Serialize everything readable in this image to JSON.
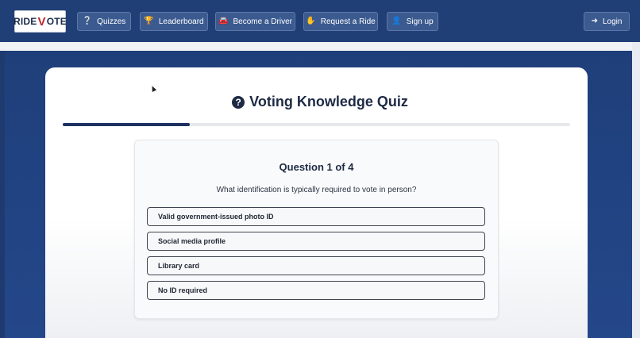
{
  "nav": {
    "logo_left": "RIDE",
    "logo_v": "V",
    "logo_right": "OTE",
    "items": [
      {
        "label": "Quizzes",
        "icon": "question-circle-icon"
      },
      {
        "label": "Leaderboard",
        "icon": "trophy-icon"
      },
      {
        "label": "Become a Driver",
        "icon": "car-icon"
      },
      {
        "label": "Request a Ride",
        "icon": "hand-icon"
      },
      {
        "label": "Sign up",
        "icon": "user-plus-icon"
      }
    ],
    "login": {
      "label": "Login",
      "icon": "login-icon"
    }
  },
  "quiz": {
    "title": "Voting Knowledge Quiz",
    "progress": 0.25,
    "question_heading": "Question 1 of 4",
    "question_text": "What identification is typically required to vote in person?",
    "options": [
      "Valid government-issued photo ID",
      "Social media profile",
      "Library card",
      "No ID required"
    ]
  },
  "colors": {
    "nav_bg": "#213f77",
    "accent": "#1d3260",
    "logo_red": "#c0262c"
  }
}
